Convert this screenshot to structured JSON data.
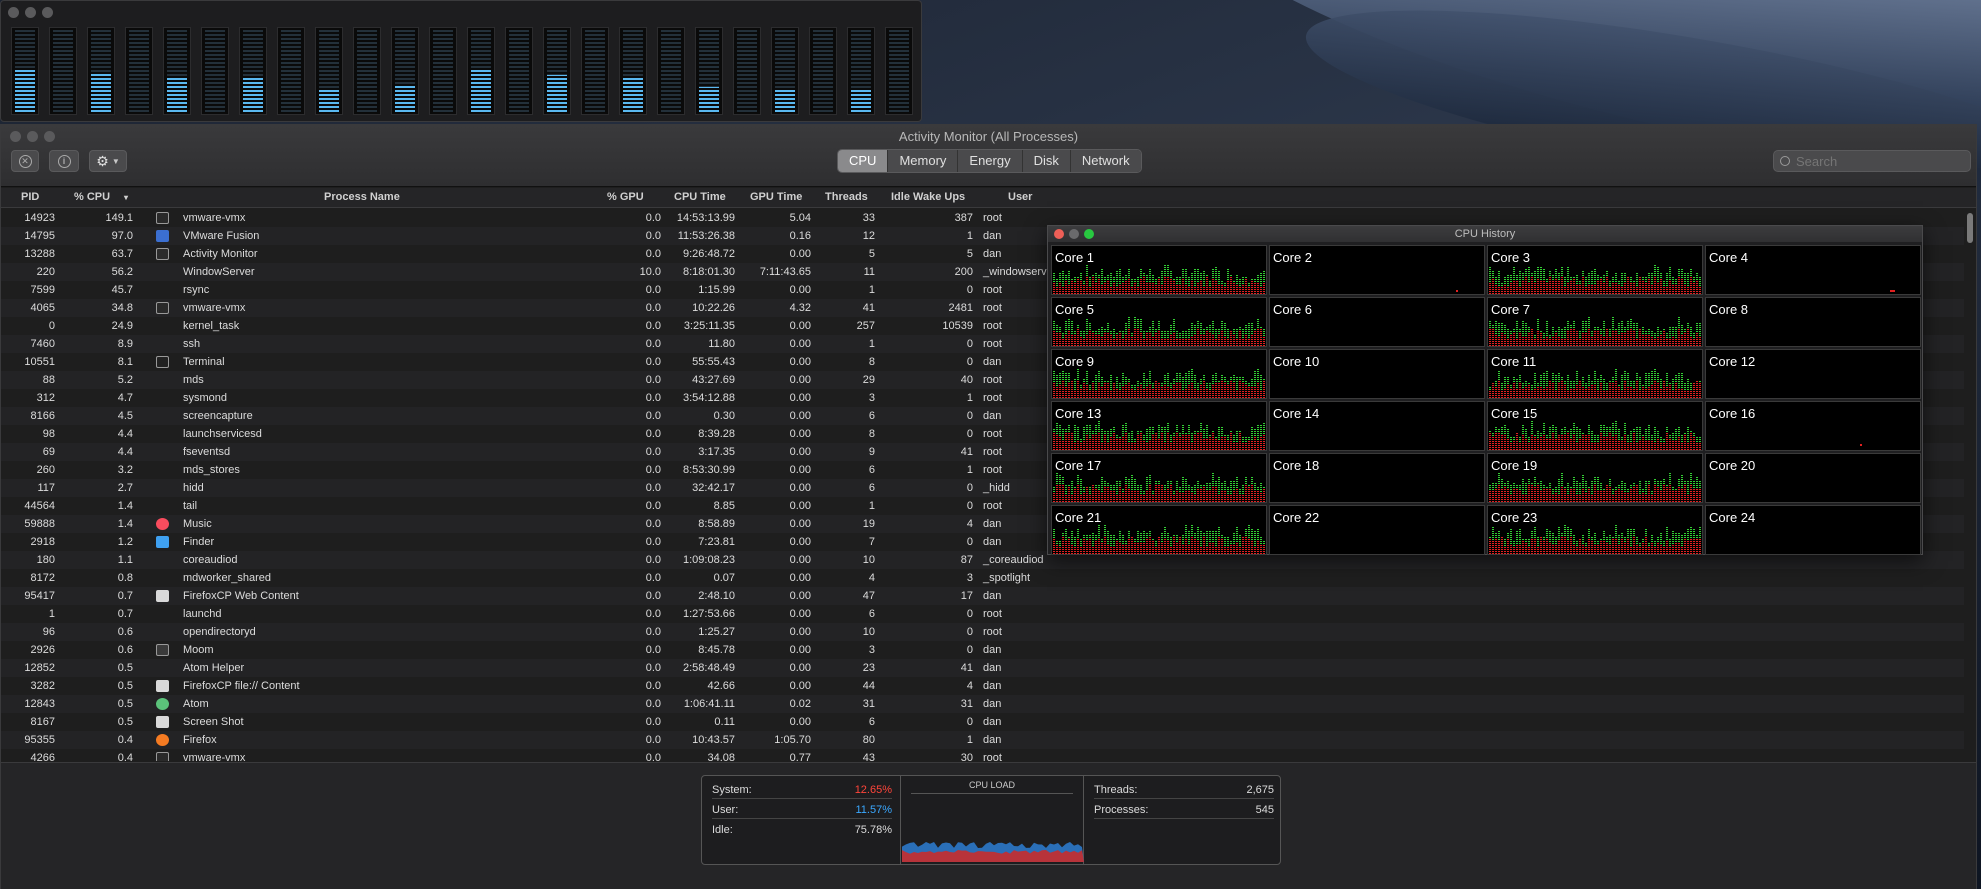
{
  "activity_monitor": {
    "title": "Activity Monitor (All Processes)",
    "tabs": [
      "CPU",
      "Memory",
      "Energy",
      "Disk",
      "Network"
    ],
    "active_tab": "CPU",
    "search_placeholder": "Search",
    "columns": [
      "PID",
      "% CPU",
      "Process Name",
      "% GPU",
      "CPU Time",
      "GPU Time",
      "Threads",
      "Idle Wake Ups",
      "User"
    ],
    "processes": [
      {
        "pid": "14923",
        "cpu": "149.1",
        "name": "vmware-vmx",
        "icon": "window-icon",
        "gpu": "0.0",
        "cpu_time": "14:53:13.99",
        "gpu_time": "5.04",
        "threads": "33",
        "idle": "387",
        "user": "root"
      },
      {
        "pid": "14795",
        "cpu": "97.0",
        "name": "VMware Fusion",
        "icon": "vmware-icon",
        "gpu": "0.0",
        "cpu_time": "11:53:26.38",
        "gpu_time": "0.16",
        "threads": "12",
        "idle": "1",
        "user": "dan"
      },
      {
        "pid": "13288",
        "cpu": "63.7",
        "name": "Activity Monitor",
        "icon": "activity-monitor-icon",
        "gpu": "0.0",
        "cpu_time": "9:26:48.72",
        "gpu_time": "0.00",
        "threads": "5",
        "idle": "5",
        "user": "dan"
      },
      {
        "pid": "220",
        "cpu": "56.2",
        "name": "WindowServer",
        "icon": "",
        "gpu": "10.0",
        "cpu_time": "8:18:01.30",
        "gpu_time": "7:11:43.65",
        "threads": "11",
        "idle": "200",
        "user": "_windowserv"
      },
      {
        "pid": "7599",
        "cpu": "45.7",
        "name": "rsync",
        "icon": "",
        "gpu": "0.0",
        "cpu_time": "1:15.99",
        "gpu_time": "0.00",
        "threads": "1",
        "idle": "0",
        "user": "root"
      },
      {
        "pid": "4065",
        "cpu": "34.8",
        "name": "vmware-vmx",
        "icon": "window-icon",
        "gpu": "0.0",
        "cpu_time": "10:22.26",
        "gpu_time": "4.32",
        "threads": "41",
        "idle": "2481",
        "user": "root"
      },
      {
        "pid": "0",
        "cpu": "24.9",
        "name": "kernel_task",
        "icon": "",
        "gpu": "0.0",
        "cpu_time": "3:25:11.35",
        "gpu_time": "0.00",
        "threads": "257",
        "idle": "10539",
        "user": "root"
      },
      {
        "pid": "7460",
        "cpu": "8.9",
        "name": "ssh",
        "icon": "",
        "gpu": "0.0",
        "cpu_time": "11.80",
        "gpu_time": "0.00",
        "threads": "1",
        "idle": "0",
        "user": "root"
      },
      {
        "pid": "10551",
        "cpu": "8.1",
        "name": "Terminal",
        "icon": "terminal-icon",
        "gpu": "0.0",
        "cpu_time": "55:55.43",
        "gpu_time": "0.00",
        "threads": "8",
        "idle": "0",
        "user": "dan"
      },
      {
        "pid": "88",
        "cpu": "5.2",
        "name": "mds",
        "icon": "",
        "gpu": "0.0",
        "cpu_time": "43:27.69",
        "gpu_time": "0.00",
        "threads": "29",
        "idle": "40",
        "user": "root"
      },
      {
        "pid": "312",
        "cpu": "4.7",
        "name": "sysmond",
        "icon": "",
        "gpu": "0.0",
        "cpu_time": "3:54:12.88",
        "gpu_time": "0.00",
        "threads": "3",
        "idle": "1",
        "user": "root"
      },
      {
        "pid": "8166",
        "cpu": "4.5",
        "name": "screencapture",
        "icon": "",
        "gpu": "0.0",
        "cpu_time": "0.30",
        "gpu_time": "0.00",
        "threads": "6",
        "idle": "0",
        "user": "dan"
      },
      {
        "pid": "98",
        "cpu": "4.4",
        "name": "launchservicesd",
        "icon": "",
        "gpu": "0.0",
        "cpu_time": "8:39.28",
        "gpu_time": "0.00",
        "threads": "8",
        "idle": "0",
        "user": "root"
      },
      {
        "pid": "69",
        "cpu": "4.4",
        "name": "fseventsd",
        "icon": "",
        "gpu": "0.0",
        "cpu_time": "3:17.35",
        "gpu_time": "0.00",
        "threads": "9",
        "idle": "41",
        "user": "root"
      },
      {
        "pid": "260",
        "cpu": "3.2",
        "name": "mds_stores",
        "icon": "",
        "gpu": "0.0",
        "cpu_time": "8:53:30.99",
        "gpu_time": "0.00",
        "threads": "6",
        "idle": "1",
        "user": "root"
      },
      {
        "pid": "117",
        "cpu": "2.7",
        "name": "hidd",
        "icon": "",
        "gpu": "0.0",
        "cpu_time": "32:42.17",
        "gpu_time": "0.00",
        "threads": "6",
        "idle": "0",
        "user": "_hidd"
      },
      {
        "pid": "44564",
        "cpu": "1.4",
        "name": "tail",
        "icon": "",
        "gpu": "0.0",
        "cpu_time": "8.85",
        "gpu_time": "0.00",
        "threads": "1",
        "idle": "0",
        "user": "root"
      },
      {
        "pid": "59888",
        "cpu": "1.4",
        "name": "Music",
        "icon": "music-icon",
        "gpu": "0.0",
        "cpu_time": "8:58.89",
        "gpu_time": "0.00",
        "threads": "19",
        "idle": "4",
        "user": "dan"
      },
      {
        "pid": "2918",
        "cpu": "1.2",
        "name": "Finder",
        "icon": "finder-icon",
        "gpu": "0.0",
        "cpu_time": "7:23.81",
        "gpu_time": "0.00",
        "threads": "7",
        "idle": "0",
        "user": "dan"
      },
      {
        "pid": "180",
        "cpu": "1.1",
        "name": "coreaudiod",
        "icon": "",
        "gpu": "0.0",
        "cpu_time": "1:09:08.23",
        "gpu_time": "0.00",
        "threads": "10",
        "idle": "87",
        "user": "_coreaudiod"
      },
      {
        "pid": "8172",
        "cpu": "0.8",
        "name": "mdworker_shared",
        "icon": "",
        "gpu": "0.0",
        "cpu_time": "0.07",
        "gpu_time": "0.00",
        "threads": "4",
        "idle": "3",
        "user": "_spotlight"
      },
      {
        "pid": "95417",
        "cpu": "0.7",
        "name": "FirefoxCP Web Content",
        "icon": "document-icon",
        "gpu": "0.0",
        "cpu_time": "2:48.10",
        "gpu_time": "0.00",
        "threads": "47",
        "idle": "17",
        "user": "dan"
      },
      {
        "pid": "1",
        "cpu": "0.7",
        "name": "launchd",
        "icon": "",
        "gpu": "0.0",
        "cpu_time": "1:27:53.66",
        "gpu_time": "0.00",
        "threads": "6",
        "idle": "0",
        "user": "root"
      },
      {
        "pid": "96",
        "cpu": "0.6",
        "name": "opendirectoryd",
        "icon": "",
        "gpu": "0.0",
        "cpu_time": "1:25.27",
        "gpu_time": "0.00",
        "threads": "10",
        "idle": "0",
        "user": "root"
      },
      {
        "pid": "2926",
        "cpu": "0.6",
        "name": "Moom",
        "icon": "moom-icon",
        "gpu": "0.0",
        "cpu_time": "8:45.78",
        "gpu_time": "0.00",
        "threads": "3",
        "idle": "0",
        "user": "dan"
      },
      {
        "pid": "12852",
        "cpu": "0.5",
        "name": "Atom Helper",
        "icon": "",
        "gpu": "0.0",
        "cpu_time": "2:58:48.49",
        "gpu_time": "0.00",
        "threads": "23",
        "idle": "41",
        "user": "dan"
      },
      {
        "pid": "3282",
        "cpu": "0.5",
        "name": "FirefoxCP file:// Content",
        "icon": "document-icon",
        "gpu": "0.0",
        "cpu_time": "42.66",
        "gpu_time": "0.00",
        "threads": "44",
        "idle": "4",
        "user": "dan"
      },
      {
        "pid": "12843",
        "cpu": "0.5",
        "name": "Atom",
        "icon": "atom-icon",
        "gpu": "0.0",
        "cpu_time": "1:06:41.11",
        "gpu_time": "0.02",
        "threads": "31",
        "idle": "31",
        "user": "dan"
      },
      {
        "pid": "8167",
        "cpu": "0.5",
        "name": "Screen Shot",
        "icon": "document-icon",
        "gpu": "0.0",
        "cpu_time": "0.11",
        "gpu_time": "0.00",
        "threads": "6",
        "idle": "0",
        "user": "dan"
      },
      {
        "pid": "95355",
        "cpu": "0.4",
        "name": "Firefox",
        "icon": "firefox-icon",
        "gpu": "0.0",
        "cpu_time": "10:43.57",
        "gpu_time": "1:05.70",
        "threads": "80",
        "idle": "1",
        "user": "dan"
      },
      {
        "pid": "4266",
        "cpu": "0.4",
        "name": "vmware-vmx",
        "icon": "window-icon",
        "gpu": "0.0",
        "cpu_time": "34.08",
        "gpu_time": "0.77",
        "threads": "43",
        "idle": "30",
        "user": "root"
      }
    ],
    "summary": {
      "system_label": "System:",
      "system_value": "12.65%",
      "user_label": "User:",
      "user_value": "11.57%",
      "idle_label": "Idle:",
      "idle_value": "75.78%",
      "load_label": "CPU LOAD",
      "threads_label": "Threads:",
      "threads_value": "2,675",
      "processes_label": "Processes:",
      "processes_value": "545"
    },
    "colors": {
      "system": "#ff453a",
      "user": "#3aa8ff",
      "core_user": "#33cc33",
      "core_system": "#e02020"
    }
  },
  "cpu_history": {
    "title": "CPU History",
    "cores": [
      "Core 1",
      "Core 2",
      "Core 3",
      "Core 4",
      "Core 5",
      "Core 6",
      "Core 7",
      "Core 8",
      "Core 9",
      "Core 10",
      "Core 11",
      "Core 12",
      "Core 13",
      "Core 14",
      "Core 15",
      "Core 16",
      "Core 17",
      "Core 18",
      "Core 19",
      "Core 20",
      "Core 21",
      "Core 22",
      "Core 23",
      "Core 24"
    ],
    "busy_cores": [
      1,
      3,
      5,
      7,
      9,
      11,
      13,
      15,
      17,
      19,
      21,
      23
    ]
  },
  "cpu_usage": {
    "core_levels": [
      0.52,
      0.0,
      0.45,
      0.0,
      0.42,
      0.0,
      0.4,
      0.0,
      0.28,
      0.0,
      0.32,
      0.0,
      0.5,
      0.0,
      0.44,
      0.0,
      0.4,
      0.0,
      0.3,
      0.0,
      0.28,
      0.0,
      0.28,
      0.0
    ]
  }
}
